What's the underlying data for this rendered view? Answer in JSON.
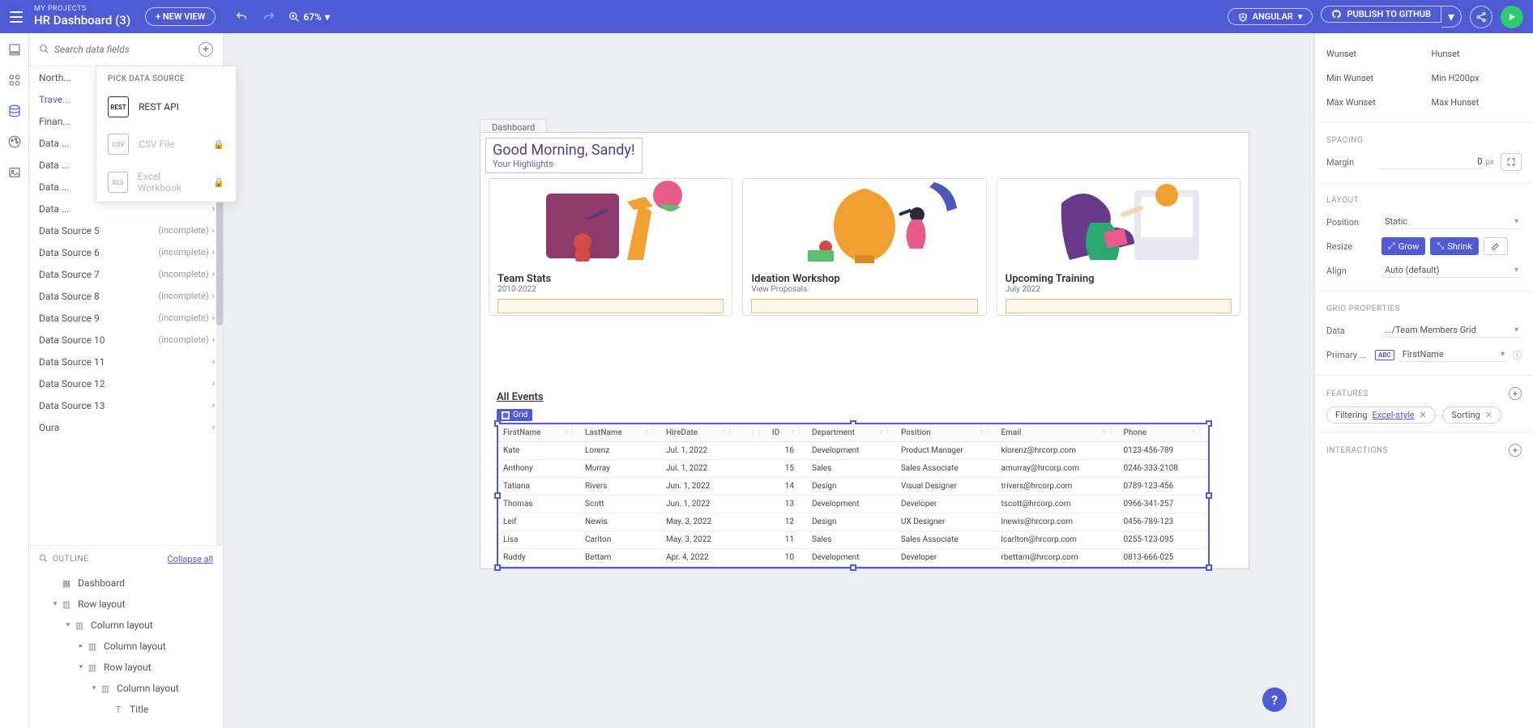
{
  "header": {
    "my_projects": "MY PROJECTS",
    "project_name": "HR Dashboard (3)",
    "new_view": "+ NEW VIEW",
    "zoom": "67%",
    "angular": "ANGULAR",
    "publish": "PUBLISH TO GITHUB"
  },
  "search": {
    "placeholder": "Search data fields"
  },
  "picker": {
    "title": "PICK DATA SOURCE",
    "rest": "REST API",
    "csv": "CSV File",
    "excel": "Excel Workbook"
  },
  "dataSources": [
    {
      "label": "North...",
      "status": ""
    },
    {
      "label": "Trave...",
      "status": ""
    },
    {
      "label": "Finan...",
      "status": ""
    },
    {
      "label": "Data ...",
      "status": ""
    },
    {
      "label": "Data ...",
      "status": ""
    },
    {
      "label": "Data ...",
      "status": ""
    },
    {
      "label": "Data ...",
      "status": ""
    },
    {
      "label": "Data Source 5",
      "status": "(incomplete)"
    },
    {
      "label": "Data Source 6",
      "status": "(incomplete)"
    },
    {
      "label": "Data Source 7",
      "status": "(incomplete)"
    },
    {
      "label": "Data Source 8",
      "status": "(incomplete)"
    },
    {
      "label": "Data Source 9",
      "status": "(incomplete)"
    },
    {
      "label": "Data Source 10",
      "status": "(incomplete)"
    },
    {
      "label": "Data Source 11",
      "status": ""
    },
    {
      "label": "Data Source 12",
      "status": ""
    },
    {
      "label": "Data Source 13",
      "status": ""
    },
    {
      "label": "Oura",
      "status": ""
    }
  ],
  "outline": {
    "title": "OUTLINE",
    "collapse": "Collapse all",
    "nodes": [
      {
        "indent": 1,
        "label": "Dashboard",
        "icon": "▦"
      },
      {
        "indent": 1,
        "label": "Row layout",
        "icon": "▥",
        "twist": "▾"
      },
      {
        "indent": 2,
        "label": "Column layout",
        "icon": "▥",
        "twist": "▾"
      },
      {
        "indent": 3,
        "label": "Column layout",
        "icon": "▥",
        "twist": "▸"
      },
      {
        "indent": 3,
        "label": "Row layout",
        "icon": "▥",
        "twist": "▾"
      },
      {
        "indent": 4,
        "label": "Column layout",
        "icon": "▥",
        "twist": "▾"
      },
      {
        "indent": 5,
        "label": "Title",
        "icon": "T"
      }
    ]
  },
  "canvas": {
    "tab": "Dashboard",
    "greeting_title": "Good Morning, Sandy!",
    "greeting_sub": "Your Highlights",
    "cards": [
      {
        "title": "Team Stats",
        "sub": "2010-2022"
      },
      {
        "title": "Ideation Workshop",
        "sub": "View Proposals"
      },
      {
        "title": "Upcoming Training",
        "sub": "July 2022"
      }
    ],
    "all_events": "All Events",
    "grid_badge": "Grid",
    "grid": {
      "cols": [
        "FirstName",
        "LastName",
        "HireDate",
        "",
        "ID",
        "Department",
        "Position",
        "Email",
        "Phone"
      ],
      "rows": [
        [
          "Kate",
          "Lorenz",
          "Jul. 1, 2022",
          "",
          "16",
          "Development",
          "Product Manager",
          "klorenz@hrcorp.com",
          "0123-456-789"
        ],
        [
          "Anthony",
          "Murray",
          "Jul. 1, 2022",
          "",
          "15",
          "Sales",
          "Sales Associate",
          "amurray@hrcorp.com",
          "0246-333-2108"
        ],
        [
          "Tatiana",
          "Rivers",
          "Jun. 1, 2022",
          "",
          "14",
          "Design",
          "Visual Designer",
          "trivers@hrcorp.com",
          "0789-123-456"
        ],
        [
          "Thomas",
          "Scott",
          "Jun. 1, 2022",
          "",
          "13",
          "Development",
          "Developer",
          "tscott@hrcorp.com",
          "0966-341-257"
        ],
        [
          "Leif",
          "Newis",
          "May. 3, 2022",
          "",
          "12",
          "Design",
          "UX Designer",
          "lnewis@hrcorp.com",
          "0456-789-123"
        ],
        [
          "Lisa",
          "Carlton",
          "May. 3, 2022",
          "",
          "11",
          "Sales",
          "Sales Associate",
          "lcarlton@hrcorp.com",
          "0255-123-095"
        ],
        [
          "Ruddy",
          "Bettam",
          "Apr. 4, 2022",
          "",
          "10",
          "Development",
          "Developer",
          "rbettam@hrcorp.com",
          "0813-666-025"
        ]
      ]
    }
  },
  "props": {
    "unset": "unset",
    "W": "W",
    "H": "H",
    "MinW": "Min W",
    "MinH": "Min H",
    "MaxW": "Max W",
    "MaxH": "Max H",
    "minH_val": "200",
    "px": "px",
    "spacing": "SPACING",
    "margin": "Margin",
    "margin_val": "0",
    "layout": "LAYOUT",
    "position": "Position",
    "position_val": "Static",
    "resize": "Resize",
    "grow": "Grow",
    "shrink": "Shrink",
    "align": "Align",
    "align_val": "Auto (default)",
    "gridprops": "GRID PROPERTIES",
    "data": "Data",
    "data_val": ".../Team Members Grid",
    "primary": "Primary ...",
    "primary_val": "FirstName",
    "features": "FEATURES",
    "filtering": "Filtering",
    "filtering_val": "Excel-style",
    "sorting": "Sorting",
    "interactions": "INTERACTIONS"
  },
  "help": "?"
}
